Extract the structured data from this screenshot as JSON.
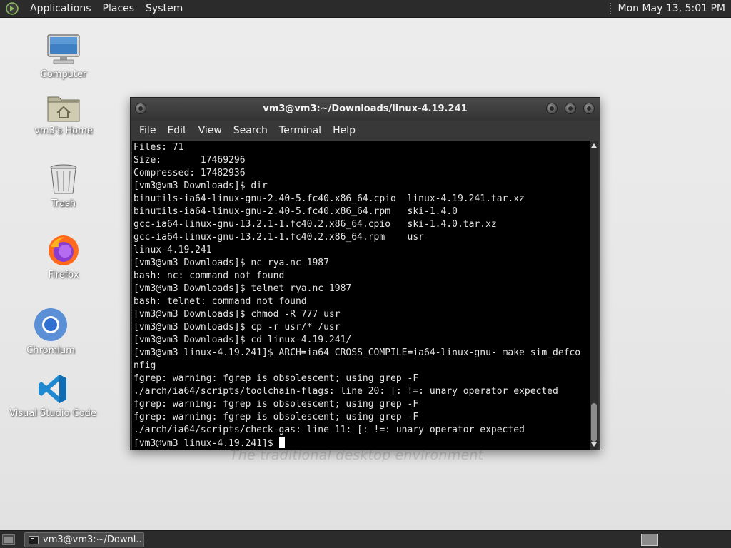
{
  "top_panel": {
    "menus": [
      "Applications",
      "Places",
      "System"
    ],
    "clock": "Mon May 13,  5:01 PM"
  },
  "desktop": {
    "icons": [
      {
        "label": "Computer",
        "icon": "computer-icon"
      },
      {
        "label": "vm3's Home",
        "icon": "home-folder-icon"
      },
      {
        "label": "Trash",
        "icon": "trash-icon"
      },
      {
        "label": "Firefox",
        "icon": "firefox-icon"
      },
      {
        "label": "Chromium",
        "icon": "chromium-icon"
      },
      {
        "label": "Visual Studio Code",
        "icon": "vscode-icon"
      }
    ],
    "wallpaper_text": "The traditional desktop environment"
  },
  "terminal": {
    "title": "vm3@vm3:~/Downloads/linux-4.19.241",
    "menu": [
      "File",
      "Edit",
      "View",
      "Search",
      "Terminal",
      "Help"
    ],
    "lines": [
      "Files: 71",
      "Size:       17469296",
      "Compressed: 17482936",
      "[vm3@vm3 Downloads]$ dir",
      "binutils-ia64-linux-gnu-2.40-5.fc40.x86_64.cpio  linux-4.19.241.tar.xz",
      "binutils-ia64-linux-gnu-2.40-5.fc40.x86_64.rpm   ski-1.4.0",
      "gcc-ia64-linux-gnu-13.2.1-1.fc40.2.x86_64.cpio   ski-1.4.0.tar.xz",
      "gcc-ia64-linux-gnu-13.2.1-1.fc40.2.x86_64.rpm    usr",
      "linux-4.19.241",
      "[vm3@vm3 Downloads]$ nc rya.nc 1987",
      "bash: nc: command not found",
      "[vm3@vm3 Downloads]$ telnet rya.nc 1987",
      "bash: telnet: command not found",
      "[vm3@vm3 Downloads]$ chmod -R 777 usr",
      "[vm3@vm3 Downloads]$ cp -r usr/* /usr",
      "[vm3@vm3 Downloads]$ cd linux-4.19.241/",
      "[vm3@vm3 linux-4.19.241]$ ARCH=ia64 CROSS_COMPILE=ia64-linux-gnu- make sim_defco",
      "nfig",
      "fgrep: warning: fgrep is obsolescent; using grep -F",
      "./arch/ia64/scripts/toolchain-flags: line 20: [: !=: unary operator expected",
      "fgrep: warning: fgrep is obsolescent; using grep -F",
      "fgrep: warning: fgrep is obsolescent; using grep -F",
      "./arch/ia64/scripts/check-gas: line 11: [: !=: unary operator expected"
    ],
    "prompt": "[vm3@vm3 linux-4.19.241]$ "
  },
  "taskbar": {
    "task_label": "vm3@vm3:~/Downl..."
  },
  "colors": {
    "panel": "#2b2b2b",
    "terminal_bg": "#000000",
    "terminal_fg": "#e4e4e4"
  }
}
